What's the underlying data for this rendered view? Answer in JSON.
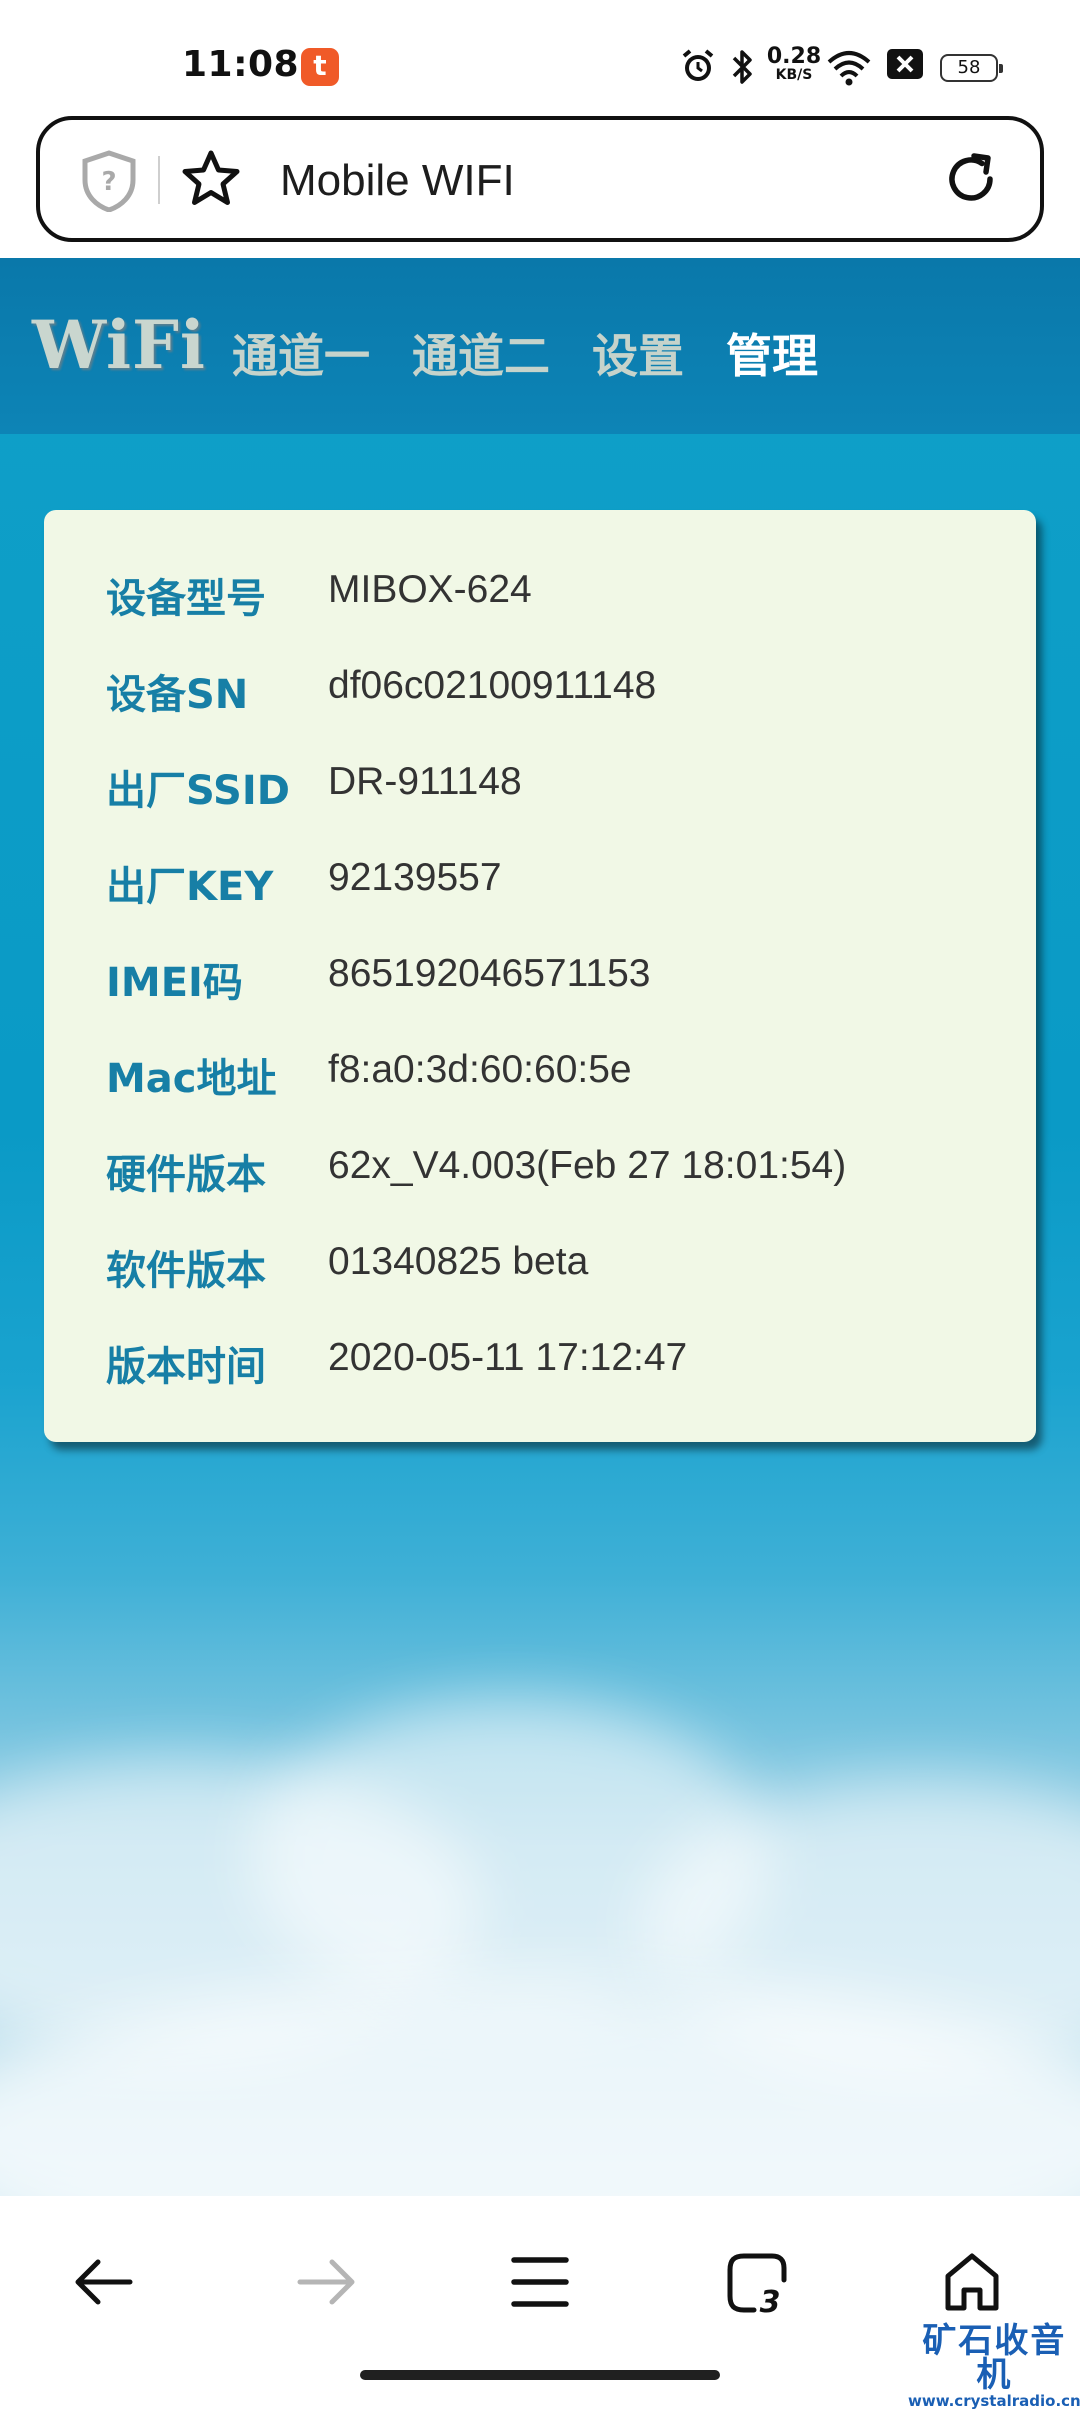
{
  "status_bar": {
    "time": "11:08",
    "notification_app": "t",
    "net_speed_value": "0.28",
    "net_speed_unit": "KB/S",
    "battery_level": "58"
  },
  "address_bar": {
    "page_title": "Mobile WIFI"
  },
  "site_nav": {
    "logo": "WiFi",
    "items": [
      {
        "label": "通道一",
        "active": false
      },
      {
        "label": "通道二",
        "active": false
      },
      {
        "label": "设置",
        "active": false
      },
      {
        "label": "管理",
        "active": true
      }
    ]
  },
  "device_info": [
    {
      "label": "设备型号",
      "value": "MIBOX-624"
    },
    {
      "label": "设备SN",
      "value": "df06c02100911148"
    },
    {
      "label": "出厂SSID",
      "value": "DR-911148"
    },
    {
      "label": "出厂KEY",
      "value": "92139557"
    },
    {
      "label": "IMEI码",
      "value": "865192046571153"
    },
    {
      "label": "Mac地址",
      "value": "f8:a0:3d:60:60:5e"
    },
    {
      "label": "硬件版本",
      "value": "62x_V4.003(Feb 27 18:01:54)"
    },
    {
      "label": "软件版本",
      "value": "01340825 beta"
    },
    {
      "label": "版本时间",
      "value": "2020-05-11 17:12:47"
    }
  ],
  "bottom_nav": {
    "tab_count": "3"
  },
  "watermark": {
    "name": "矿石收音机",
    "url": "www.crystalradio.cn"
  }
}
